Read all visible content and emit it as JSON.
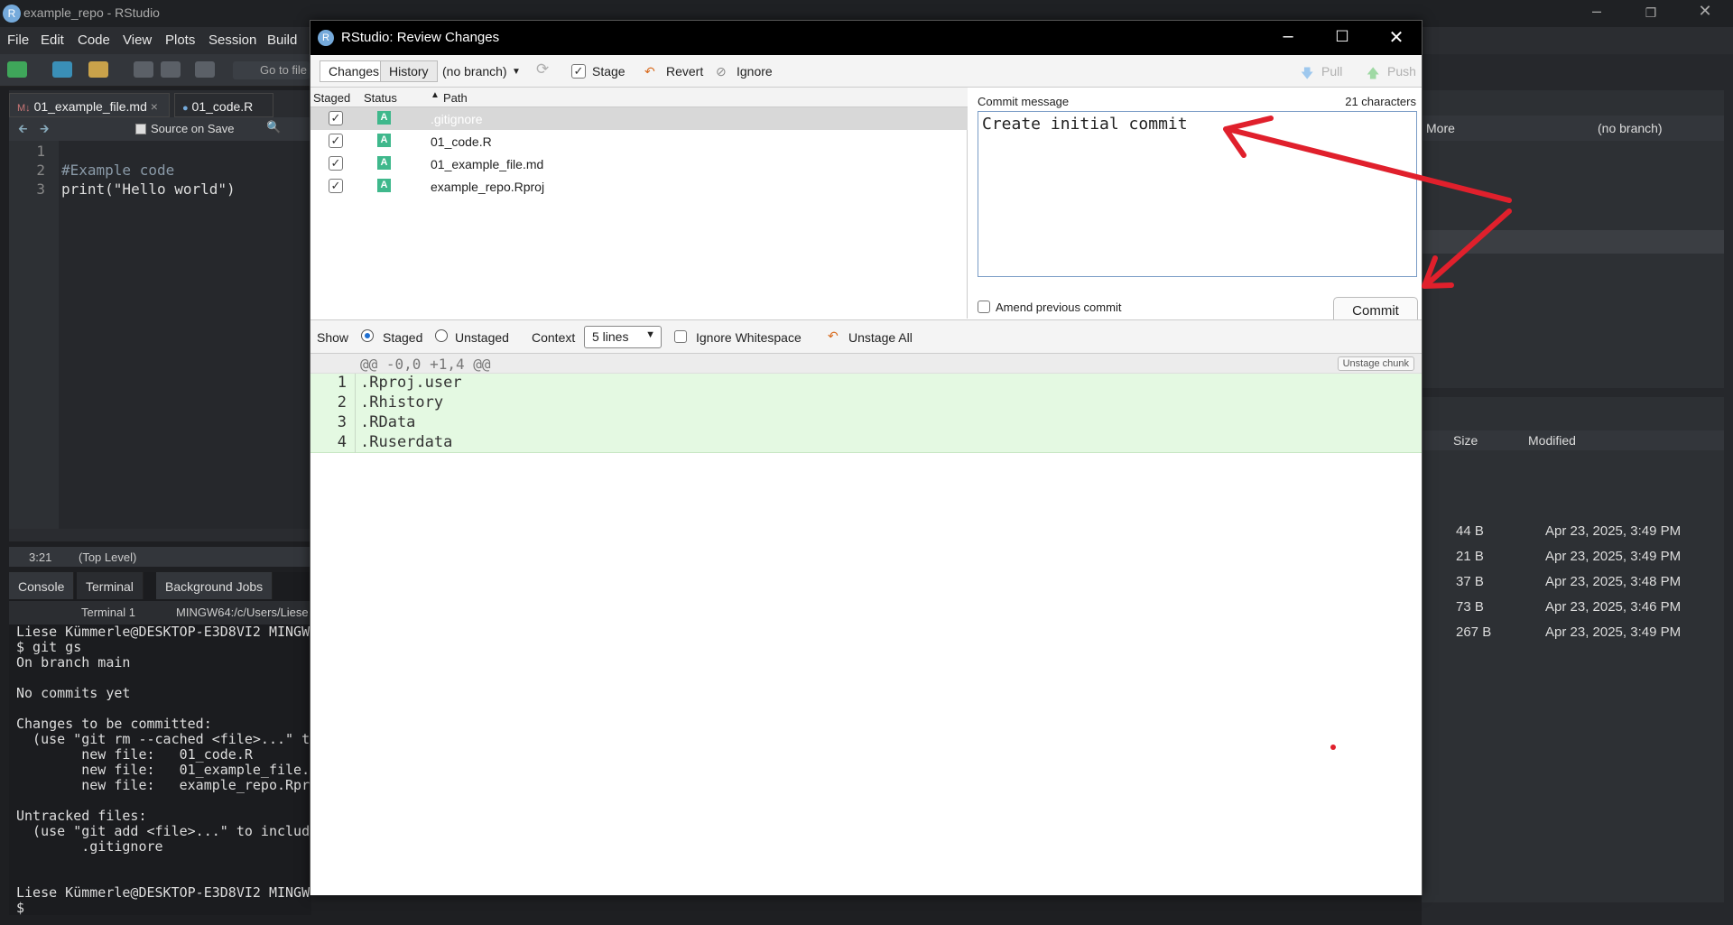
{
  "window": {
    "title": "example_repo - RStudio",
    "logo": "R"
  },
  "menu": [
    "File",
    "Edit",
    "Code",
    "View",
    "Plots",
    "Session",
    "Build"
  ],
  "toolbar": {
    "goto_label": "Go to file"
  },
  "project": {
    "name": "example_repo"
  },
  "source": {
    "tabs": [
      "01_example_file.md",
      "01_code.R"
    ],
    "source_on_save": "Source on Save",
    "lines": [
      {
        "n": "1",
        "code": ""
      },
      {
        "n": "2",
        "code": "#Example code"
      },
      {
        "n": "3",
        "code": "print(\"Hello world\")"
      }
    ],
    "status_pos": "3:21",
    "status_scope": "(Top Level)"
  },
  "console": {
    "tabs": [
      "Console",
      "Terminal",
      "Background Jobs"
    ],
    "terminal_select": "Terminal 1",
    "terminal_path": "MINGW64:/c/Users/Liese",
    "text": "Liese Kümmerle@DESKTOP-E3D8VI2 MINGW\n$ git gs\nOn branch main\n\nNo commits yet\n\nChanges to be committed:\n  (use \"git rm --cached <file>...\" t\n        new file:   01_code.R\n        new file:   01_example_file.\n        new file:   example_repo.Rpr\n\nUntracked files:\n  (use \"git add <file>...\" to includ\n        .gitignore\n\n\nLiese Kümmerle@DESKTOP-E3D8VI2 MINGW\n$ "
  },
  "right_pane": {
    "more": "More",
    "branch": "(no branch)",
    "files_header": {
      "size": "Size",
      "modified": "Modified"
    },
    "files": [
      {
        "size": "44 B",
        "modified": "Apr 23, 2025, 3:49 PM"
      },
      {
        "size": "21 B",
        "modified": "Apr 23, 2025, 3:49 PM"
      },
      {
        "size": "37 B",
        "modified": "Apr 23, 2025, 3:48 PM"
      },
      {
        "size": "73 B",
        "modified": "Apr 23, 2025, 3:46 PM"
      },
      {
        "size": "267 B",
        "modified": "Apr 23, 2025, 3:49 PM"
      }
    ]
  },
  "dialog": {
    "title": "RStudio: Review Changes",
    "tabs": {
      "changes": "Changes",
      "history": "History"
    },
    "branch": "(no branch)",
    "stage": "Stage",
    "revert": "Revert",
    "ignore": "Ignore",
    "pull": "Pull",
    "push": "Push",
    "list_header": {
      "staged": "Staged",
      "status": "Status",
      "path": "Path"
    },
    "files": [
      {
        "path": ".gitignore",
        "status": "A",
        "staged": true,
        "selected": true
      },
      {
        "path": "01_code.R",
        "status": "A",
        "staged": true,
        "selected": false
      },
      {
        "path": "01_example_file.md",
        "status": "A",
        "staged": true,
        "selected": false
      },
      {
        "path": "example_repo.Rproj",
        "status": "A",
        "staged": true,
        "selected": false
      }
    ],
    "commit_label": "Commit message",
    "char_count": "21 characters",
    "commit_message": "Create initial commit",
    "amend_label": "Amend previous commit",
    "commit_button": "Commit",
    "show_label": "Show",
    "staged_radio": "Staged",
    "unstaged_radio": "Unstaged",
    "context_label": "Context",
    "context_value": "5 lines",
    "ignore_ws": "Ignore Whitespace",
    "unstage_all": "Unstage All",
    "hunk_header": "@@ -0,0 +1,4 @@",
    "unstage_chunk": "Unstage chunk",
    "diff_lines": [
      {
        "n": "1",
        "text": ".Rproj.user"
      },
      {
        "n": "2",
        "text": ".Rhistory"
      },
      {
        "n": "3",
        "text": ".RData"
      },
      {
        "n": "4",
        "text": ".Ruserdata"
      }
    ]
  },
  "colors": {
    "accent": "#75aadb",
    "annotation": "#e0202c",
    "added_bg": "#e4f9e2",
    "status_added": "#3fb88c"
  }
}
